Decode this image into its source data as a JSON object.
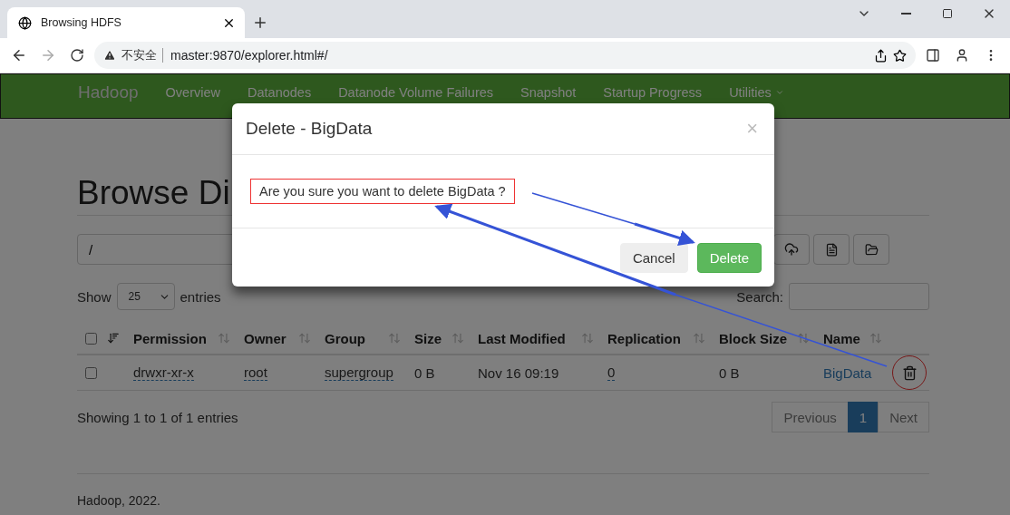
{
  "browser": {
    "tab_title": "Browsing HDFS",
    "security_label": "不安全",
    "url": "master:9870/explorer.html#/"
  },
  "navbar": {
    "brand": "Hadoop",
    "items": [
      {
        "label": "Overview",
        "dropdown": false
      },
      {
        "label": "Datanodes",
        "dropdown": false
      },
      {
        "label": "Datanode Volume Failures",
        "dropdown": false
      },
      {
        "label": "Snapshot",
        "dropdown": false
      },
      {
        "label": "Startup Progress",
        "dropdown": false
      },
      {
        "label": "Utilities",
        "dropdown": true
      }
    ]
  },
  "page": {
    "heading": "Browse Di",
    "path": "/",
    "show_label": "Show",
    "page_size": "25",
    "entries_label": "entries",
    "search_label": "Search:",
    "select_all_checked": false,
    "columns": [
      "Permission",
      "Owner",
      "Group",
      "Size",
      "Last Modified",
      "Replication",
      "Block Size",
      "Name"
    ],
    "rows": [
      {
        "checked": false,
        "cells": [
          {
            "text": "drwxr-xr-x",
            "kind": "underlined"
          },
          {
            "text": "root",
            "kind": "underlined"
          },
          {
            "text": "supergroup",
            "kind": "underlined"
          },
          {
            "text": "0 B",
            "kind": "plain"
          },
          {
            "text": "Nov 16 09:19",
            "kind": "plain"
          },
          {
            "text": "0",
            "kind": "underlined"
          },
          {
            "text": "0 B",
            "kind": "plain"
          },
          {
            "text": "BigData",
            "kind": "link"
          }
        ]
      }
    ],
    "info": "Showing 1 to 1 of 1 entries",
    "pagination": [
      {
        "label": "Previous",
        "selected": false
      },
      {
        "label": "1",
        "selected": true
      },
      {
        "label": "Next",
        "selected": false
      }
    ],
    "footer": "Hadoop, 2022."
  },
  "dialog": {
    "title": "Delete - BigData",
    "close": "×",
    "message": "Are you sure you want to delete BigData ?",
    "buttons": [
      {
        "label": "Cancel",
        "kind": "default"
      },
      {
        "label": "Delete",
        "kind": "success"
      }
    ]
  }
}
